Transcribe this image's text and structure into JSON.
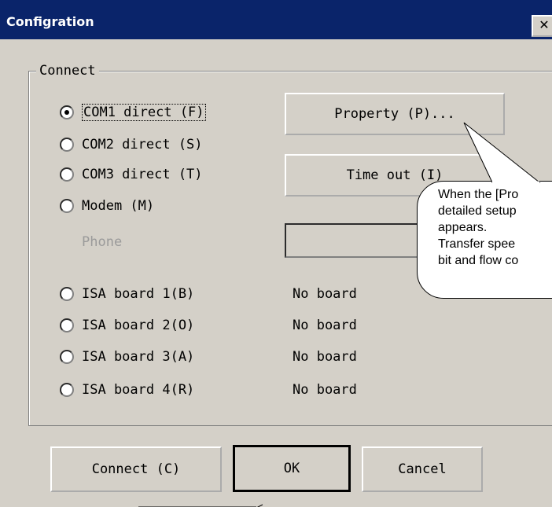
{
  "window": {
    "title": "Configration",
    "close_label": "✕"
  },
  "group": {
    "label": "Connect"
  },
  "radios": [
    {
      "label": "COM1 direct (F)",
      "underline": "F",
      "checked": true
    },
    {
      "label": "COM2 direct (S)",
      "underline": "S",
      "checked": false
    },
    {
      "label": "COM3 direct (T)",
      "underline": "T",
      "checked": false
    },
    {
      "label": "Modem (M)",
      "underline": "M",
      "checked": false
    },
    {
      "label": "ISA board 1(B)",
      "underline": "B",
      "checked": false
    },
    {
      "label": "ISA board 2(O)",
      "underline": "O",
      "checked": false
    },
    {
      "label": "ISA board 3(A)",
      "underline": "A",
      "checked": false
    },
    {
      "label": "ISA board 4(R)",
      "underline": "R",
      "checked": false
    }
  ],
  "buttons": {
    "property": "Property (P)...",
    "timeout": "Time out (I)",
    "connect": "Connect (C)",
    "ok": "OK",
    "cancel": "Cancel"
  },
  "phone": {
    "label": "Phone",
    "value": ""
  },
  "boards": [
    "No board",
    "No board",
    "No board",
    "No board"
  ],
  "callout": {
    "lines": [
      "When the [Pro",
      "detailed setup",
      "appears.",
      "Transfer spee",
      "bit and flow co"
    ]
  }
}
